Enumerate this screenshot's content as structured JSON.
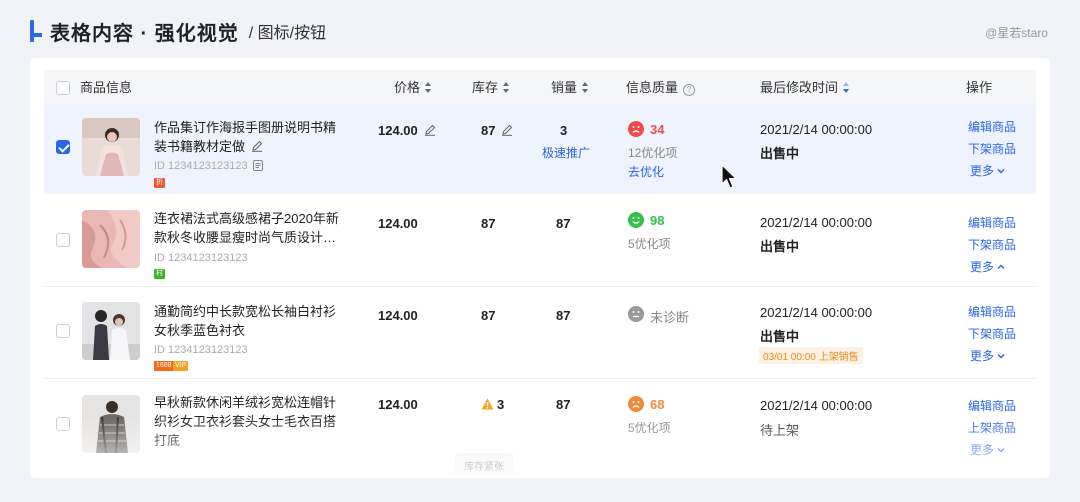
{
  "header": {
    "title": "表格内容 · 强化视觉",
    "subtitle": "/ 图标/按钮",
    "watermark": "@星若staro"
  },
  "table": {
    "columns": {
      "product": "商品信息",
      "price": "价格",
      "stock": "库存",
      "sales": "销量",
      "quality": "信息质量",
      "modified": "最后修改时间",
      "actions": "操作"
    },
    "help_glyph": "?",
    "rows": [
      {
        "checked": true,
        "name": "作品集订作海报手图册说明书精装书籍教材定做",
        "id": "ID 1234123123123",
        "tags": [
          {
            "text": "折",
            "color": "#ef5a2c"
          }
        ],
        "price": "124.00",
        "stock": "87",
        "sales": "3",
        "sales_link": "极速推广",
        "quality_face": "sad",
        "quality_color": "#f04a4a",
        "score": "34",
        "optimize_count": "12优化项",
        "optimize_link": "去优化",
        "modified": "2021/2/14 00:00:00",
        "status": "出售中",
        "actions": [
          "编辑商品",
          "下架商品"
        ],
        "more": "更多",
        "more_dir": "down"
      },
      {
        "checked": false,
        "name": "连衣裙法式高级感裙子2020年新款秋冬收腰显瘦时尚气质设计…",
        "id": "ID 1234123123123",
        "tags": [
          {
            "text": "村",
            "color": "#3fb52c"
          }
        ],
        "price": "124.00",
        "stock": "87",
        "sales": "87",
        "quality_face": "happy",
        "quality_color": "#34c24a",
        "score": "98",
        "optimize_count": "5优化项",
        "modified": "2021/2/14 00:00:00",
        "status": "出售中",
        "actions": [
          "编辑商品",
          "下架商品"
        ],
        "more": "更多",
        "more_dir": "up"
      },
      {
        "checked": false,
        "name": "通勤简约中长款宽松长袖白衬衫女秋季蓝色衬衣",
        "id": "ID 1234123123123",
        "tags": [
          {
            "text": "1688",
            "color": "#f26a1b"
          },
          {
            "text": "VIP",
            "color": "#f5a02a"
          }
        ],
        "price": "124.00",
        "stock": "87",
        "sales": "87",
        "quality_face": "neutral",
        "quality_color": "#999999",
        "quality_text": "未诊断",
        "modified": "2021/2/14 00:00:00",
        "status": "出售中",
        "schedule": "03/01 00:00 上架销售",
        "actions": [
          "编辑商品",
          "下架商品"
        ],
        "more": "更多",
        "more_dir": "down"
      },
      {
        "checked": false,
        "name": "早秋新款休闲羊绒衫宽松连帽针织衫女卫衣衫套头女士毛衣百搭打底",
        "price": "124.00",
        "stock": "3",
        "stock_warning": "库存紧张",
        "sales": "87",
        "quality_face": "sad",
        "quality_color": "#f28a3a",
        "score": "68",
        "optimize_count": "5优化项",
        "modified": "2021/2/14 00:00:00",
        "status": "待上架",
        "actions": [
          "编辑商品",
          "上架商品"
        ],
        "more": "更多",
        "more_dir": "down"
      }
    ]
  }
}
